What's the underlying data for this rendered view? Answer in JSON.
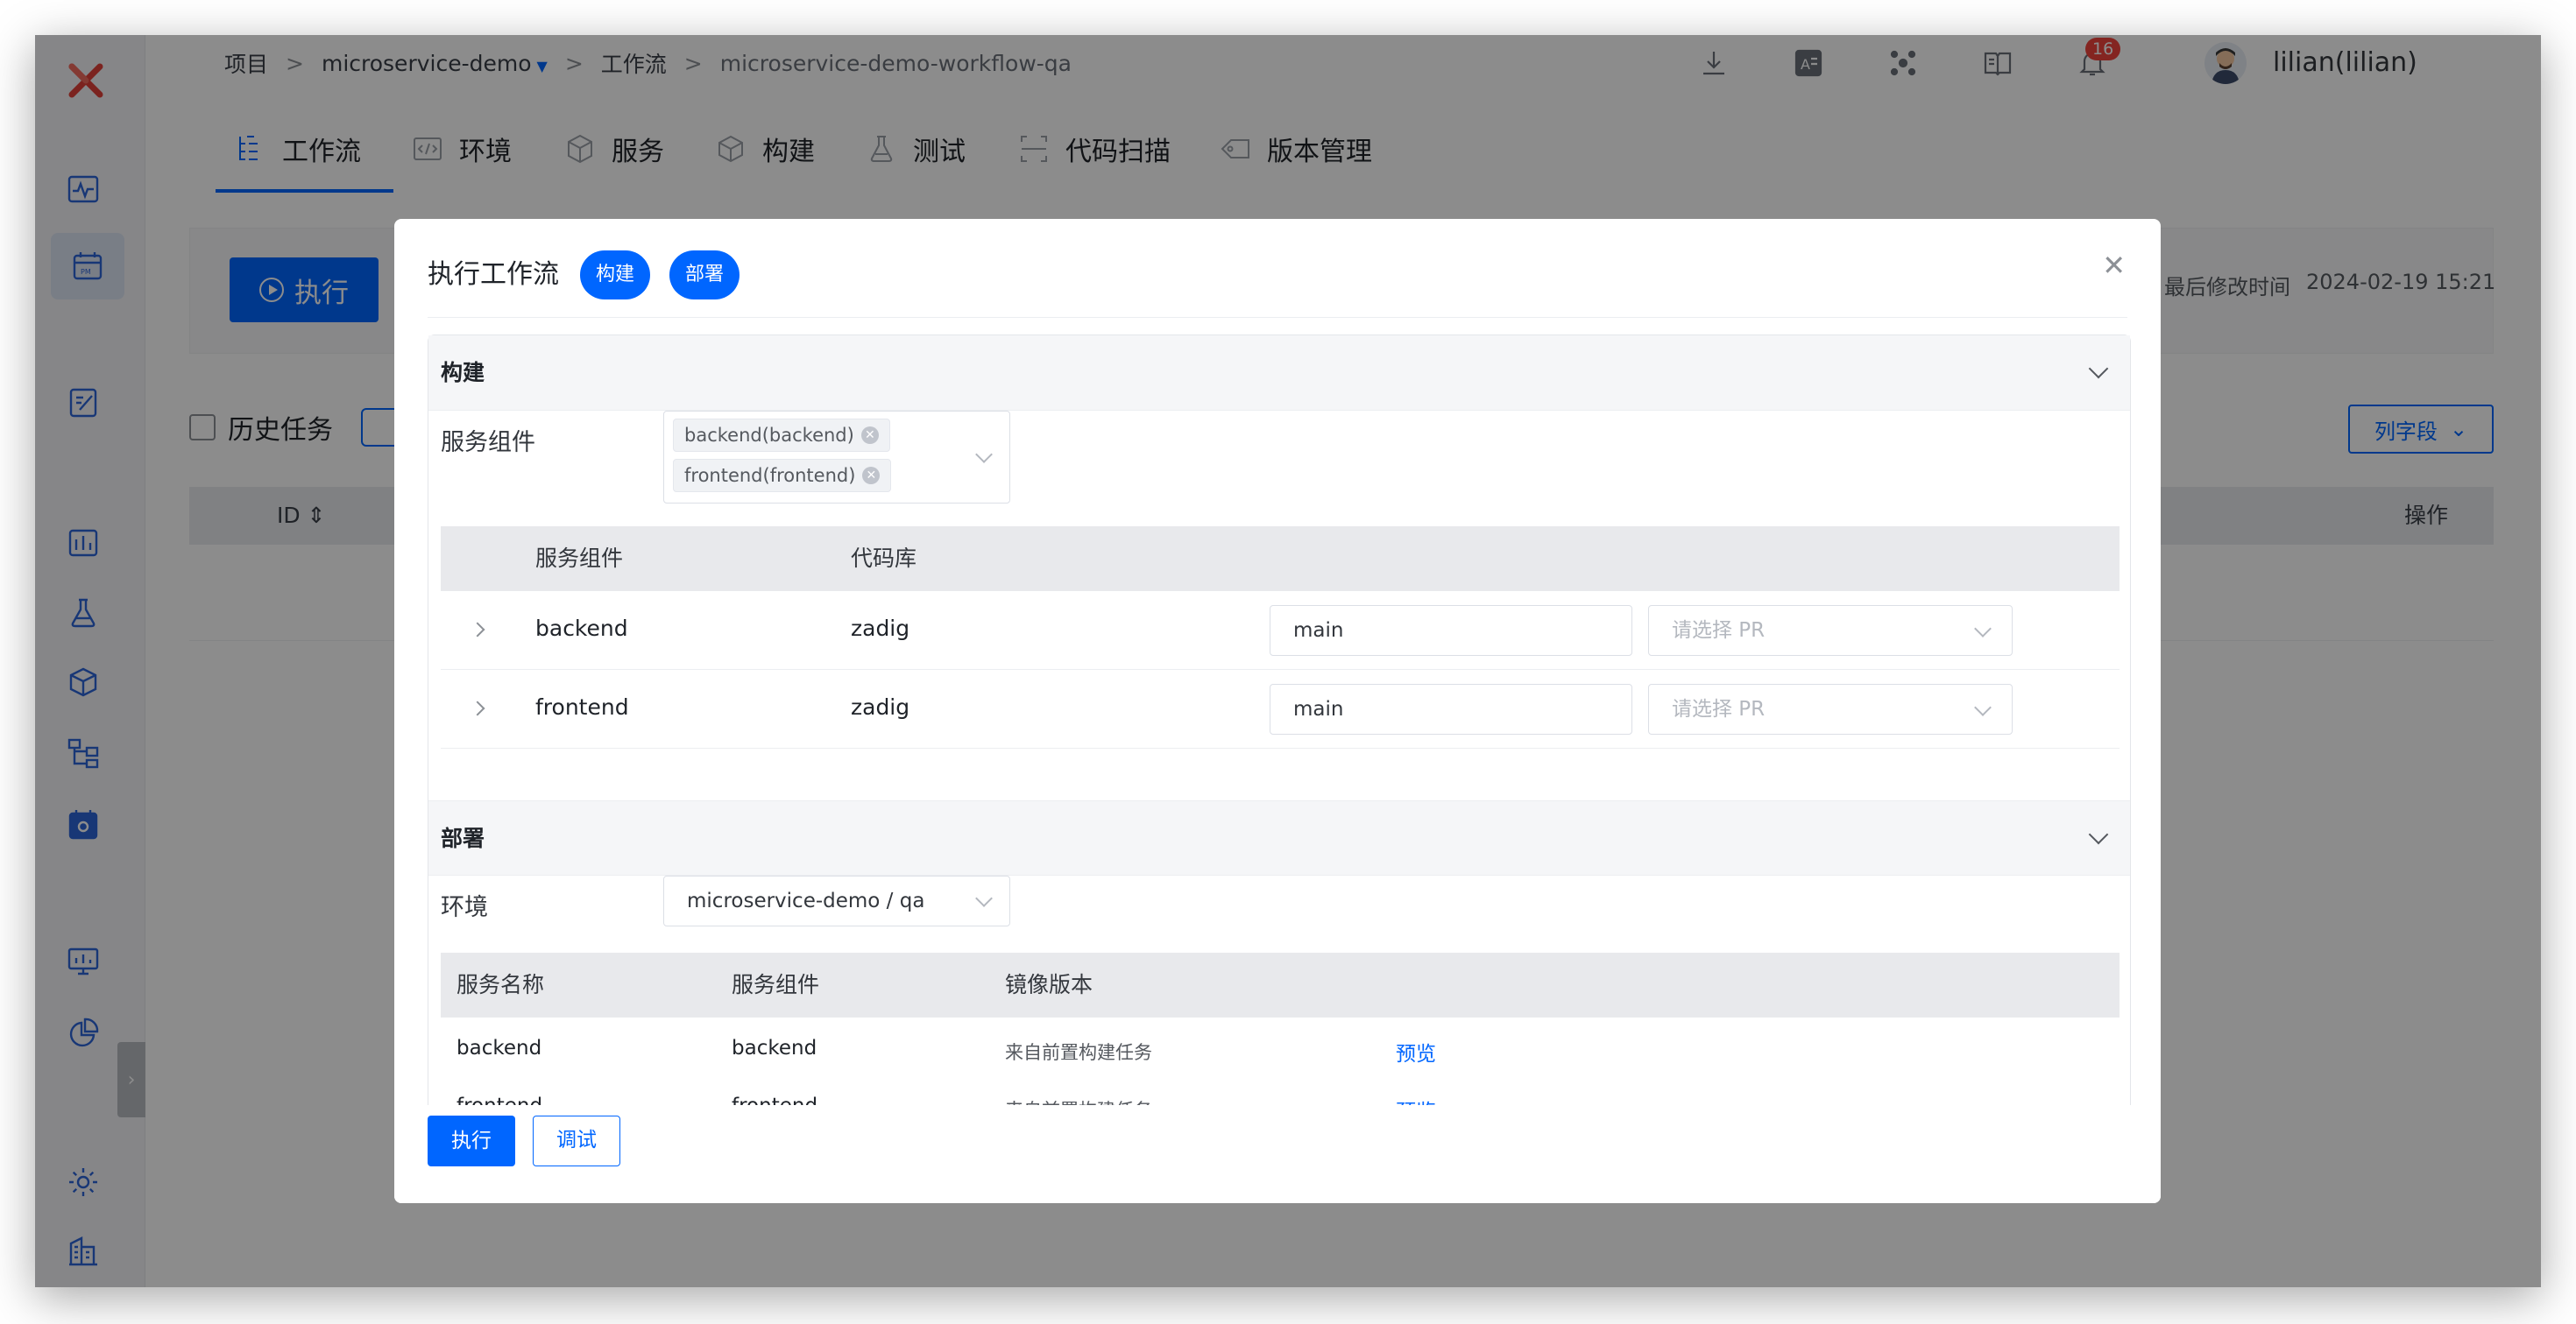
{
  "colors": {
    "accent": "#0066ff",
    "badge": "#f0443c",
    "overlay": "rgba(0,0,0,0.45)"
  },
  "sidebar": {
    "icons": [
      "zadig-logo-icon",
      "pulse-chart-icon",
      "pm-board-icon",
      "edit-doc-icon",
      "dashboard-icon",
      "flask-icon",
      "package-icon",
      "hierarchy-icon",
      "calendar-gear-icon",
      "monitor-chart-icon",
      "pie-chart-icon",
      "settings-gear-icon",
      "building-icon"
    ]
  },
  "breadcrumb": {
    "root": "项目",
    "project": "microservice-demo",
    "section": "工作流",
    "current": "microservice-demo-workflow-qa"
  },
  "topbar": {
    "notification_count": "16",
    "username": "lilian(lilian)"
  },
  "tabs": [
    {
      "label": "工作流",
      "icon": "workflow-icon"
    },
    {
      "label": "环境",
      "icon": "code-env-icon"
    },
    {
      "label": "服务",
      "icon": "service-cube-icon"
    },
    {
      "label": "构建",
      "icon": "build-box-icon"
    },
    {
      "label": "测试",
      "icon": "test-flask-icon"
    },
    {
      "label": "代码扫描",
      "icon": "scan-icon"
    },
    {
      "label": "版本管理",
      "icon": "version-tag-icon"
    }
  ],
  "background": {
    "run_label": "执行",
    "last_modified_label": "最后修改时间",
    "last_modified_value": "2024-02-19 15:21",
    "history_label": "历史任务",
    "columns_button": "列字段",
    "table_id_header": "ID",
    "table_op_header": "操作"
  },
  "modal": {
    "title": "执行工作流",
    "pills": [
      "构建",
      "部署"
    ],
    "build": {
      "title": "构建",
      "service_label": "服务组件",
      "selected_services": [
        "backend(backend)",
        "frontend(frontend)"
      ],
      "table_headers": {
        "service": "服务组件",
        "repo": "代码库"
      },
      "rows": [
        {
          "service": "backend",
          "repo": "zadig",
          "branch": "main",
          "pr_placeholder": "请选择 PR"
        },
        {
          "service": "frontend",
          "repo": "zadig",
          "branch": "main",
          "pr_placeholder": "请选择 PR"
        }
      ]
    },
    "deploy": {
      "title": "部署",
      "env_label": "环境",
      "env_value": "microservice-demo / qa",
      "table_headers": {
        "name": "服务名称",
        "service": "服务组件",
        "image": "镜像版本"
      },
      "rows": [
        {
          "name": "backend",
          "service": "backend",
          "image": "来自前置构建任务",
          "action": "预览"
        },
        {
          "name": "frontend",
          "service": "frontend",
          "image": "来自前置构建任务",
          "action": "预览"
        }
      ]
    },
    "footer": {
      "run": "执行",
      "debug": "调试"
    }
  }
}
